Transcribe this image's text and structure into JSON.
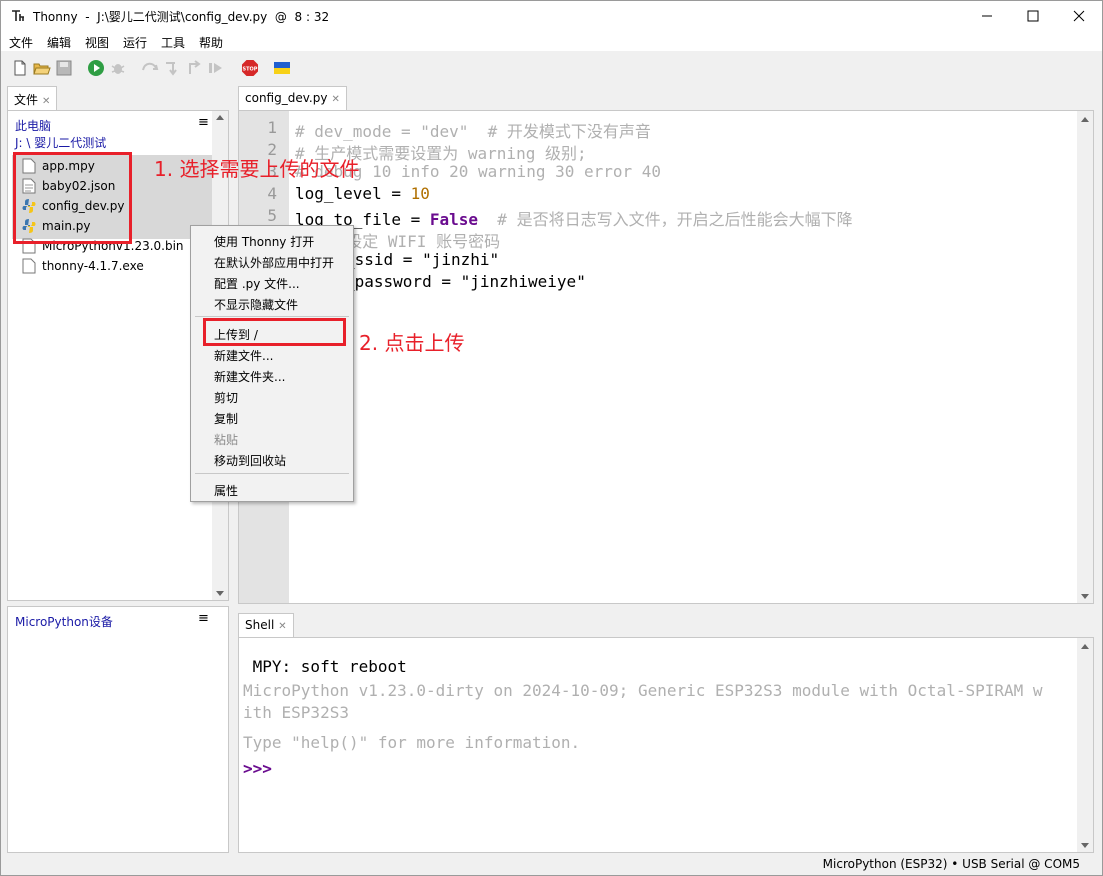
{
  "window": {
    "title": "Thonny  -  J:\\婴儿二代测试\\config_dev.py  @  8 : 32"
  },
  "menu": [
    "文件",
    "编辑",
    "视图",
    "运行",
    "工具",
    "帮助"
  ],
  "files_panel": {
    "tab_label": "文件",
    "path_root": "此电脑",
    "path_dir": "J: \\ 婴儿二代测试",
    "files": [
      {
        "name": "app.mpy",
        "icon": "file-icon"
      },
      {
        "name": "baby02.json",
        "icon": "json-file-icon"
      },
      {
        "name": "config_dev.py",
        "icon": "python-file-icon"
      },
      {
        "name": "main.py",
        "icon": "python-file-icon"
      },
      {
        "name": "MicroPythonv1.23.0.bin",
        "icon": "file-icon"
      },
      {
        "name": "thonny-4.1.7.exe",
        "icon": "file-icon"
      }
    ]
  },
  "device_panel": {
    "title": "MicroPython设备"
  },
  "editor": {
    "tab_label": "config_dev.py",
    "line_numbers": [
      "1",
      "2",
      "3",
      "4",
      "5"
    ],
    "lines": {
      "l1": "# dev_mode = \"dev\"  # 开发模式下没有声音",
      "l2": "# 生产模式需要设置为 warning 级别;",
      "l3": "# debug 10 info 20 warning 30 error 40",
      "l4a": "log_level = ",
      "l4b": "10",
      "l5a": "log_to_file = ",
      "l5b": "False",
      "l5c": "  # 是否将日志写入文件，开启之后性能会大幅下降",
      "l6": "# 自己设定 WIFI 账号密码",
      "l7": "_ssid = \"jinzhi\"",
      "l8": "_password = \"jinzhiweiye\""
    }
  },
  "shell": {
    "tab_label": "Shell",
    "line1": " MPY: soft reboot",
    "line2": "MicroPython v1.23.0-dirty on 2024-10-09; Generic ESP32S3 module with Octal-SPIRAM w",
    "line3": "ith ESP32S3",
    "line4": "Type \"help()\" for more information.",
    "prompt": ">>>"
  },
  "context_menu": {
    "items": [
      "使用 Thonny 打开",
      "在默认外部应用中打开",
      "配置 .py 文件...",
      "不显示隐藏文件",
      "上传到 /",
      "新建文件...",
      "新建文件夹...",
      "剪切",
      "复制",
      "粘贴",
      "移动到回收站",
      "属性"
    ]
  },
  "annotations": {
    "step1": "1. 选择需要上传的文件",
    "step2": "2. 点击上传"
  },
  "status": "MicroPython (ESP32)  •  USB Serial @ COM5",
  "colors": {
    "annotation": "#e8202a",
    "path_link": "#1a1aa6",
    "keyword": "#6a0c8f",
    "number": "#b07000"
  }
}
